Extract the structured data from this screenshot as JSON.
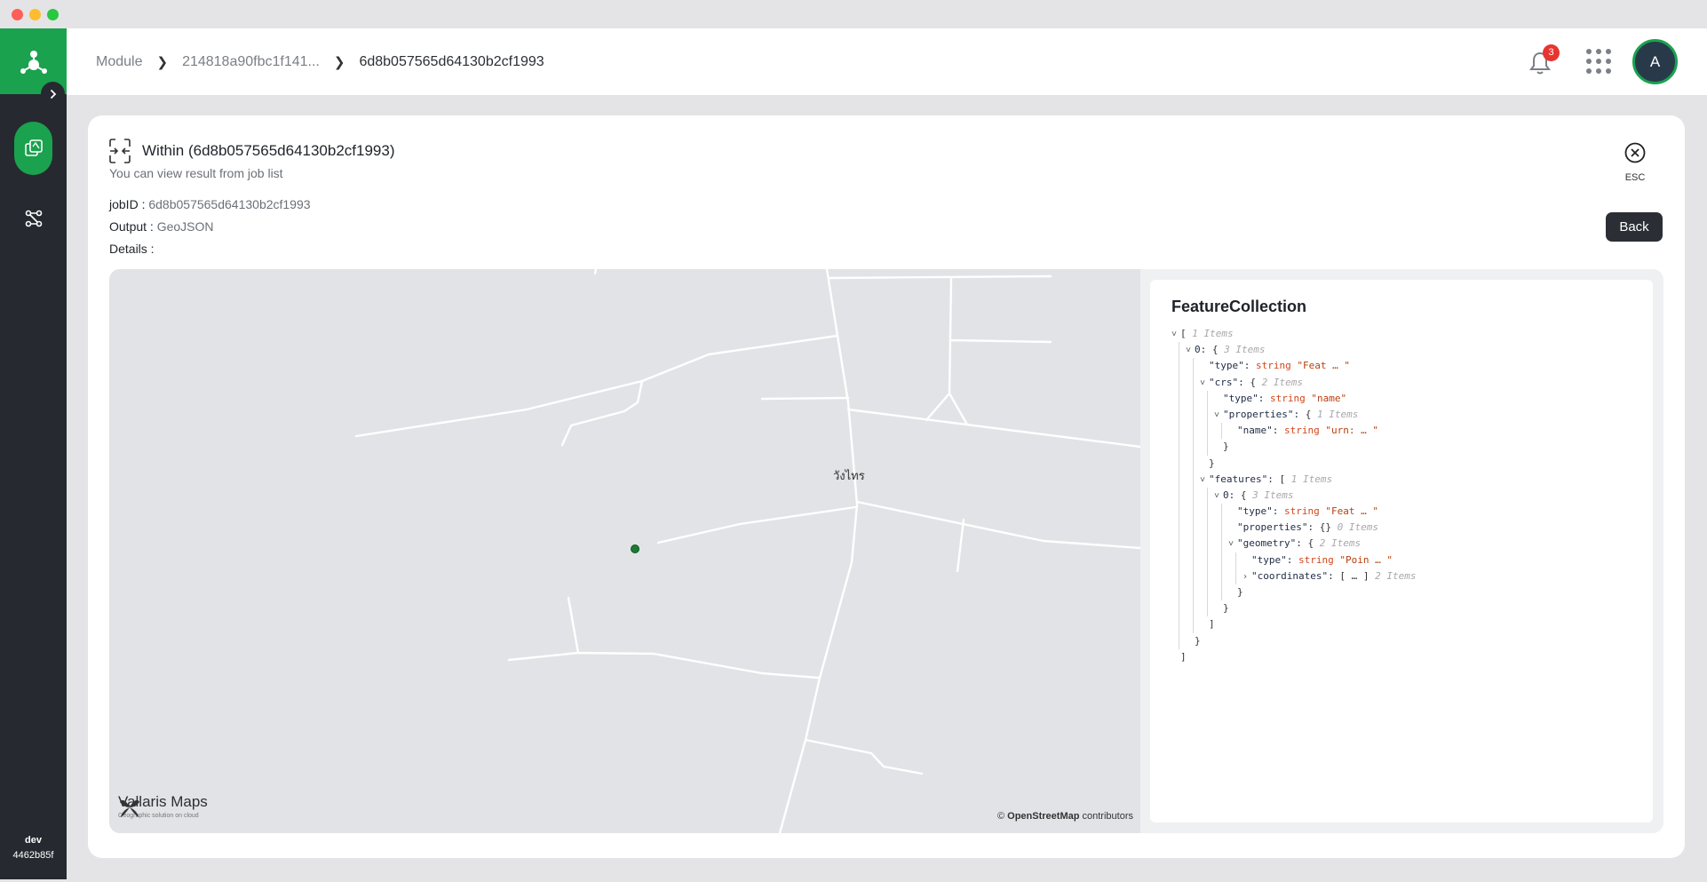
{
  "window": {
    "controls": [
      "close",
      "minimize",
      "maximize"
    ]
  },
  "sidebar": {
    "items": [
      {
        "name": "layers",
        "icon": "layers-icon",
        "active": true
      },
      {
        "name": "workflow",
        "icon": "workflow-icon",
        "active": false
      }
    ],
    "env_name": "dev",
    "env_id": "4462b85f"
  },
  "header": {
    "breadcrumb": [
      "Module",
      "214818a90fbc1f141...",
      "6d8b057565d64130b2cf1993"
    ],
    "notification_count": "3",
    "avatar_initial": "A"
  },
  "card": {
    "title": "Within (6d8b057565d64130b2cf1993)",
    "subtitle": "You can view result from job list",
    "job_id_label": "jobID :",
    "job_id": "6d8b057565d64130b2cf1993",
    "output_label": "Output :",
    "output": "GeoJSON",
    "details_label": "Details :",
    "esc_label": "ESC",
    "back_label": "Back"
  },
  "map": {
    "place_label": "วังไทร",
    "logo_name": "Vallaris Maps",
    "logo_tagline": "Geographic solution on cloud",
    "attribution_prefix": "©",
    "attribution_link": "OpenStreetMap",
    "attribution_suffix": "contributors",
    "point_color": "#1d7a33"
  },
  "json_viewer": {
    "title": "FeatureCollection",
    "lines": [
      {
        "depth": 0,
        "caret": "v",
        "text": "[",
        "note": "1 Items"
      },
      {
        "depth": 1,
        "caret": "v",
        "key": "0:",
        "text": "{",
        "note": "3 Items"
      },
      {
        "depth": 2,
        "caret": "",
        "key": "\"type\":",
        "type": "string",
        "value": "\"Feat … \""
      },
      {
        "depth": 2,
        "caret": "v",
        "key": "\"crs\":",
        "text": "{",
        "note": "2 Items"
      },
      {
        "depth": 3,
        "caret": "",
        "key": "\"type\":",
        "type": "string",
        "value": "\"name\""
      },
      {
        "depth": 3,
        "caret": "v",
        "key": "\"properties\":",
        "text": "{",
        "note": "1 Items"
      },
      {
        "depth": 4,
        "caret": "",
        "key": "\"name\":",
        "type": "string",
        "value": "\"urn: … \""
      },
      {
        "depth": 3,
        "caret": "",
        "text": "}"
      },
      {
        "depth": 2,
        "caret": "",
        "text": "}"
      },
      {
        "depth": 2,
        "caret": "v",
        "key": "\"features\":",
        "text": "[",
        "note": "1 Items"
      },
      {
        "depth": 3,
        "caret": "v",
        "key": "0:",
        "text": "{",
        "note": "3 Items"
      },
      {
        "depth": 4,
        "caret": "",
        "key": "\"type\":",
        "type": "string",
        "value": "\"Feat … \""
      },
      {
        "depth": 4,
        "caret": "",
        "key": "\"properties\":",
        "text": "{}",
        "note": "0 Items"
      },
      {
        "depth": 4,
        "caret": "v",
        "key": "\"geometry\":",
        "text": "{",
        "note": "2 Items"
      },
      {
        "depth": 5,
        "caret": "",
        "key": "\"type\":",
        "type": "string",
        "value": "\"Poin … \""
      },
      {
        "depth": 5,
        "caret": ">",
        "key": "\"coordinates\":",
        "text": "[ … ]",
        "note": "2 Items"
      },
      {
        "depth": 4,
        "caret": "",
        "text": "}"
      },
      {
        "depth": 3,
        "caret": "",
        "text": "}"
      },
      {
        "depth": 2,
        "caret": "",
        "text": "]"
      },
      {
        "depth": 1,
        "caret": "",
        "text": "}"
      },
      {
        "depth": 0,
        "caret": "",
        "text": "]"
      }
    ]
  },
  "colors": {
    "brand_green": "#1aa24e",
    "sidebar_bg": "#262a30",
    "badge_red": "#e8342f"
  }
}
